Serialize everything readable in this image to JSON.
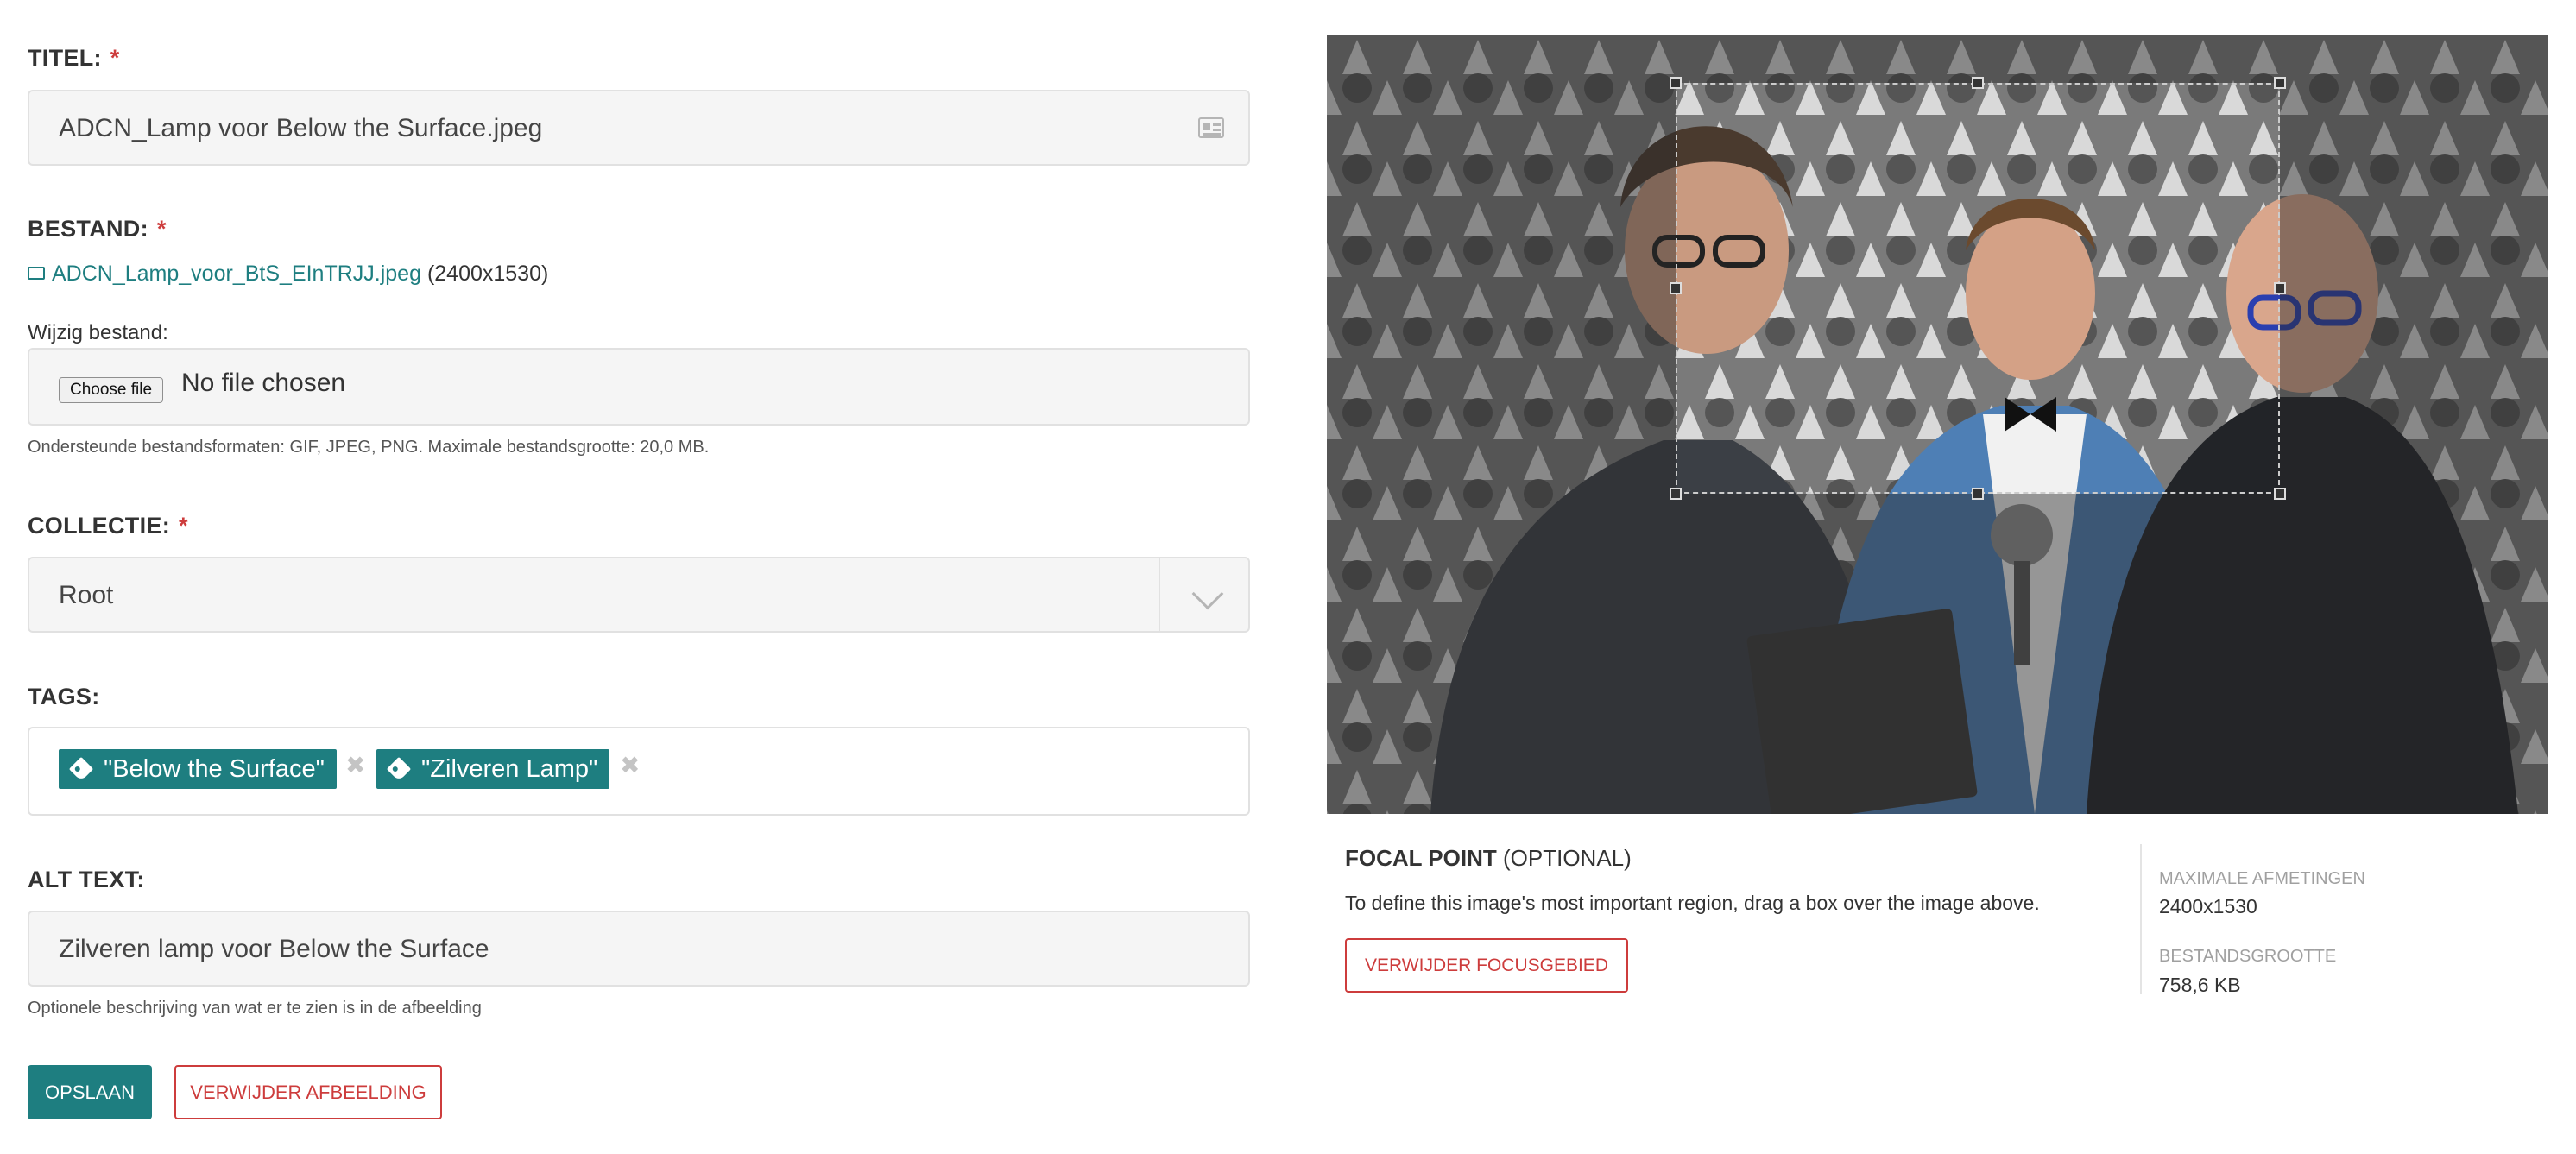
{
  "title_field": {
    "label": "TITEL:",
    "required_mark": "*",
    "value": "ADCN_Lamp voor Below the Surface.jpeg",
    "icon": "id-card-icon"
  },
  "file_field": {
    "label": "BESTAND:",
    "required_mark": "*",
    "file_name": "ADCN_Lamp_voor_BtS_EInTRJJ.jpeg",
    "file_dimensions": "(2400x1530)",
    "change_label": "Wijzig bestand:",
    "choose_button": "Choose file",
    "no_file_text": "No file chosen",
    "help": "Ondersteunde bestandsformaten: GIF, JPEG, PNG. Maximale bestandsgrootte: 20,0 MB."
  },
  "collection_field": {
    "label": "COLLECTIE:",
    "required_mark": "*",
    "value": "Root"
  },
  "tags_field": {
    "label": "TAGS:",
    "tags": [
      "\"Below the Surface\"",
      "\"Zilveren Lamp\""
    ],
    "remove_glyph": "✖"
  },
  "alt_field": {
    "label": "ALT TEXT:",
    "value": "Zilveren lamp voor Below the Surface",
    "help": "Optionele beschrijving van wat er te zien is in de afbeelding"
  },
  "actions": {
    "save": "OPSLAAN",
    "delete_image": "VERWIJDER AFBEELDING"
  },
  "focal_point": {
    "title": "FOCAL POINT",
    "title_suffix": "(OPTIONAL)",
    "description": "To define this image's most important region, drag a box over the image above.",
    "remove_button": "VERWIJDER FOCUSGEBIED"
  },
  "meta": {
    "max_dimensions_label": "MAXIMALE AFMETINGEN",
    "max_dimensions_value": "2400x1530",
    "file_size_label": "BESTANDSGROOTTE",
    "file_size_value": "758,6 KB"
  },
  "colors": {
    "accent": "#1e7e80",
    "danger": "#cd3c3c",
    "field_bg": "#f5f5f5",
    "border": "#e1e1e1"
  }
}
